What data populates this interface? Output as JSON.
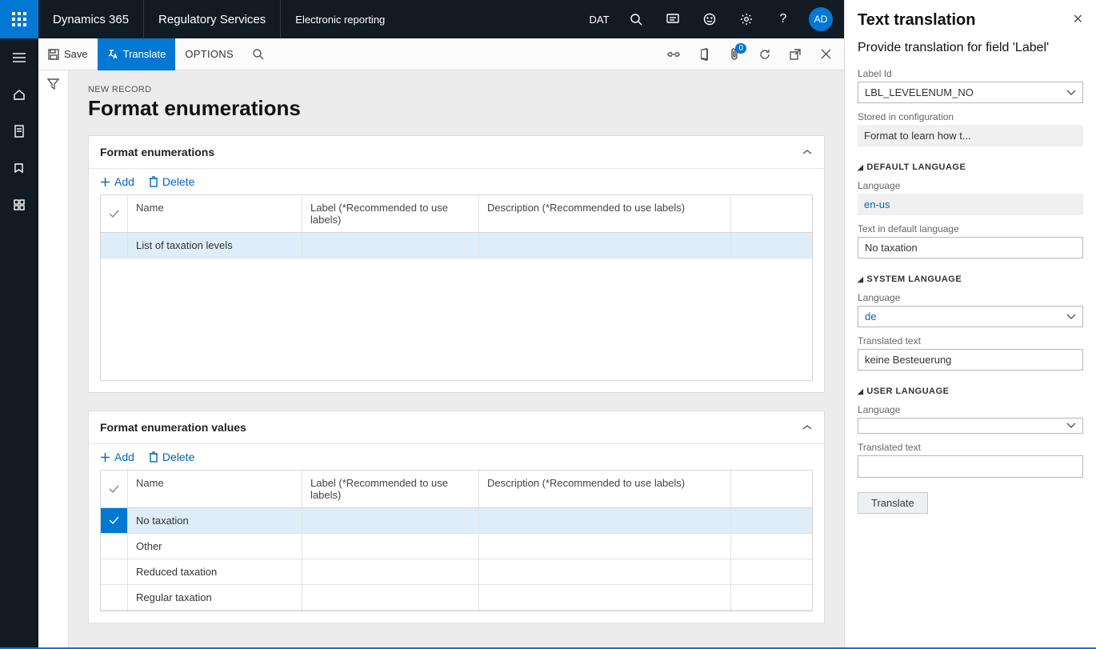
{
  "header": {
    "brand": "Dynamics 365",
    "area": "Regulatory Services",
    "module": "Electronic reporting",
    "company": "DAT",
    "avatar": "AD"
  },
  "actionbar": {
    "save": "Save",
    "translate": "Translate",
    "options": "OPTIONS",
    "attachBadge": "0"
  },
  "page": {
    "crumb": "NEW RECORD",
    "title": "Format enumerations"
  },
  "section1": {
    "title": "Format enumerations",
    "add": "Add",
    "delete": "Delete",
    "cols": {
      "name": "Name",
      "label": "Label (*Recommended to use labels)",
      "desc": "Description (*Recommended to use labels)"
    },
    "rows": [
      {
        "name": "List of taxation levels",
        "label": "",
        "desc": "",
        "selected": true,
        "primary": false
      }
    ]
  },
  "section2": {
    "title": "Format enumeration values",
    "add": "Add",
    "delete": "Delete",
    "cols": {
      "name": "Name",
      "label": "Label (*Recommended to use labels)",
      "desc": "Description (*Recommended to use labels)"
    },
    "rows": [
      {
        "name": "No taxation",
        "label": "",
        "desc": "",
        "selected": true,
        "primary": true
      },
      {
        "name": "Other",
        "label": "",
        "desc": "",
        "selected": false,
        "primary": false
      },
      {
        "name": "Reduced taxation",
        "label": "",
        "desc": "",
        "selected": false,
        "primary": false
      },
      {
        "name": "Regular taxation",
        "label": "",
        "desc": "",
        "selected": false,
        "primary": false
      }
    ]
  },
  "rightPanel": {
    "title": "Text translation",
    "subtitle": "Provide translation for field 'Label'",
    "labelIdLabel": "Label Id",
    "labelId": "LBL_LEVELENUM_NO",
    "storedLabel": "Stored in configuration",
    "stored": "Format to learn how t...",
    "defaultLang": {
      "section": "DEFAULT LANGUAGE",
      "langLabel": "Language",
      "lang": "en-us",
      "textLabel": "Text in default language",
      "text": "No taxation"
    },
    "systemLang": {
      "section": "SYSTEM LANGUAGE",
      "langLabel": "Language",
      "lang": "de",
      "textLabel": "Translated text",
      "text": "keine Besteuerung"
    },
    "userLang": {
      "section": "USER LANGUAGE",
      "langLabel": "Language",
      "lang": "",
      "textLabel": "Translated text",
      "text": ""
    },
    "translateBtn": "Translate"
  }
}
